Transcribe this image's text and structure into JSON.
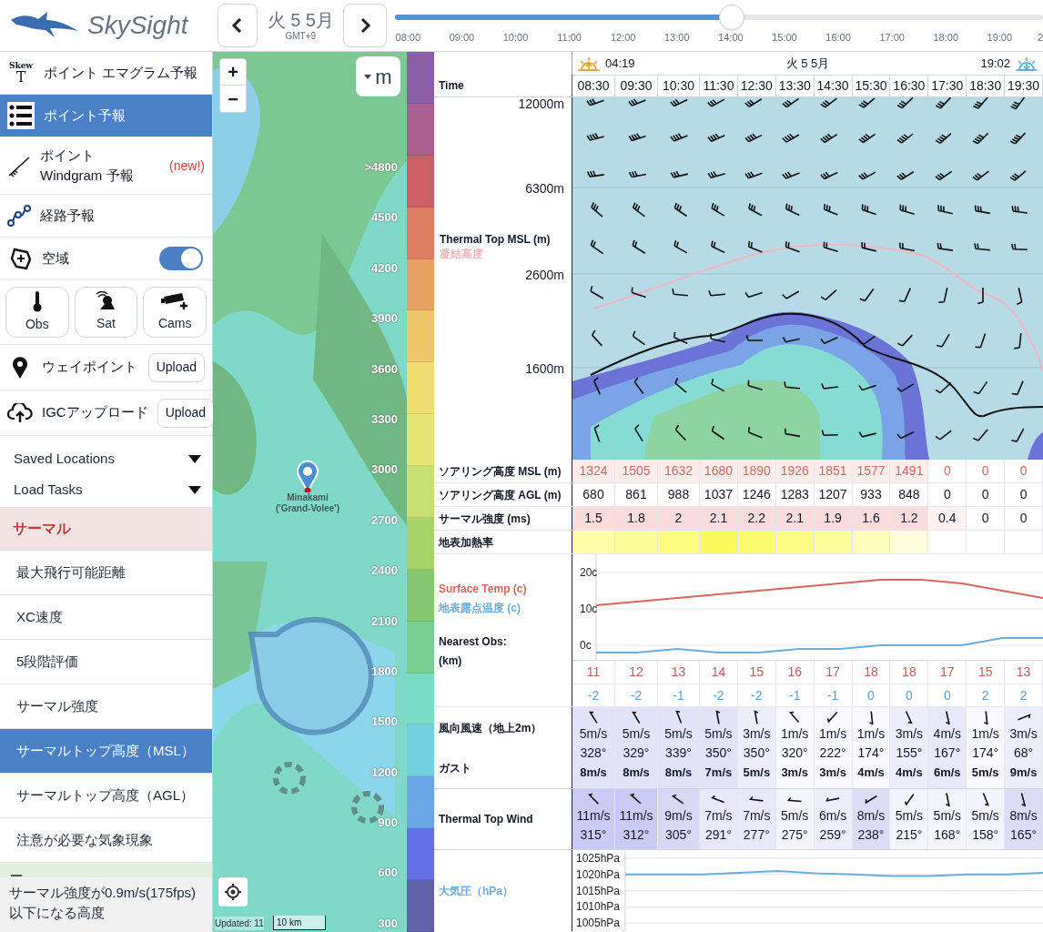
{
  "app": {
    "logo_text": "SkySight"
  },
  "date_nav": {
    "date": "火 5 5月",
    "timezone": "GMT+9"
  },
  "time_slider": {
    "level": 0.52,
    "ticks": [
      "08:00",
      "09:00",
      "10:00",
      "11:00",
      "12:00",
      "13:00",
      "14:00",
      "15:00",
      "16:00",
      "17:00",
      "18:00",
      "19:00",
      "2"
    ]
  },
  "sidebar": {
    "menu": [
      {
        "kind": "link",
        "icon_text": [
          "Skew",
          "T"
        ],
        "label": "ポイント エマグラム予報",
        "selected": false
      },
      {
        "kind": "link",
        "label": "ポイント予報",
        "selected": true
      },
      {
        "kind": "link",
        "label": "ポイント Windgram 予報",
        "badge": "(new!)",
        "selected": false
      },
      {
        "kind": "link",
        "label": "経路予報",
        "selected": false
      },
      {
        "kind": "toggle",
        "label": "空域",
        "on": true
      }
    ],
    "layer_buttons": [
      "Obs",
      "Sat",
      "Cams"
    ],
    "uploads": [
      {
        "label": "ウェイポイント",
        "button": "Upload"
      },
      {
        "label": "IGCアップロード",
        "button": "Upload"
      }
    ],
    "dropdowns": [
      "Saved Locations",
      "Load Tasks"
    ],
    "section": {
      "title": "サーマル",
      "items": [
        {
          "label": "最大飛行可能距離",
          "selected": false
        },
        {
          "label": "XC速度",
          "selected": false
        },
        {
          "label": "5段階評価",
          "selected": false
        },
        {
          "label": "サーマル強度",
          "selected": false
        },
        {
          "label": "サーマルトップ高度（MSL）",
          "selected": true
        },
        {
          "label": "サーマルトップ高度（AGL）",
          "selected": false
        },
        {
          "label": "注意が必要な気象現象",
          "selected": false
        }
      ]
    },
    "description": "サーマル強度が0.9m/s(175fps)以下になる高度"
  },
  "map": {
    "zoom_in": "+",
    "zoom_out": "−",
    "unit": "m",
    "pin_label": [
      "Minakami",
      "('Grand-Volee')"
    ],
    "updated": "Updated: 11",
    "scale": "10 km"
  },
  "legend": {
    "bands": [
      {
        "color": "#8c5ea6"
      },
      {
        "color": "#aa6090"
      },
      {
        "color": "#cd6067"
      },
      {
        "color": "#de7e62"
      },
      {
        "color": "#e9a163"
      },
      {
        "color": "#eec76a"
      },
      {
        "color": "#f0dd70"
      },
      {
        "color": "#e6e674"
      },
      {
        "color": "#c8e072"
      },
      {
        "color": "#a6d46a"
      },
      {
        "color": "#86c872"
      },
      {
        "color": "#7ad092"
      },
      {
        "color": "#78dcc6"
      },
      {
        "color": "#72d0e2"
      },
      {
        "color": "#6aa6e8"
      },
      {
        "color": "#6470e6"
      },
      {
        "color": "#6262aa"
      }
    ],
    "labels": [
      ">4800",
      "4500",
      "4200",
      "3900",
      "3600",
      "3300",
      "3000",
      "2700",
      "2400",
      "2100",
      "1800",
      "1500",
      "1200",
      "900",
      "600",
      "300"
    ]
  },
  "forecast": {
    "sunrise": "04:19",
    "date": "火 5 5月",
    "sunset": "19:02",
    "time_label": "Time",
    "times": [
      "08:30",
      "09:30",
      "10:30",
      "11:30",
      "12:30",
      "13:30",
      "14:30",
      "15:30",
      "16:30",
      "17:30",
      "18:30",
      "19:30"
    ],
    "cross_section": {
      "labels": [
        "Thermal Top MSL (m)",
        "凝結高度"
      ],
      "axis_ticks": [
        "12000m",
        "6300m",
        "2600m",
        "1600m"
      ]
    },
    "rows": [
      {
        "kind": "msl",
        "label": "ソアリング高度 MSL (m)",
        "cells": [
          {
            "text": "1324",
            "color": "#fcecec"
          },
          {
            "text": "1505",
            "color": "#fcecec"
          },
          {
            "text": "1632",
            "color": "#fcecec"
          },
          {
            "text": "1680",
            "color": "#fcecec"
          },
          {
            "text": "1890",
            "color": "#fcecec"
          },
          {
            "text": "1926",
            "color": "#fcecec"
          },
          {
            "text": "1851",
            "color": "#fcecec"
          },
          {
            "text": "1577",
            "color": "#fcecec"
          },
          {
            "text": "1491",
            "color": "#fcecec"
          },
          {
            "text": "0",
            "color": "#ffffff"
          },
          {
            "text": "0",
            "color": "#ffffff"
          },
          {
            "text": "0",
            "color": "#ffffff"
          }
        ]
      },
      {
        "kind": "agl",
        "label": "ソアリング高度 AGL (m)",
        "cells": [
          {
            "text": "680"
          },
          {
            "text": "861"
          },
          {
            "text": "988"
          },
          {
            "text": "1037"
          },
          {
            "text": "1246"
          },
          {
            "text": "1283"
          },
          {
            "text": "1207"
          },
          {
            "text": "933"
          },
          {
            "text": "848"
          },
          {
            "text": "0"
          },
          {
            "text": "0"
          },
          {
            "text": "0"
          }
        ]
      },
      {
        "kind": "strength",
        "label": "サーマル強度 (ms)",
        "cells": [
          {
            "text": "1.5",
            "color": "#fadcdc"
          },
          {
            "text": "1.8",
            "color": "#fadcdc"
          },
          {
            "text": "2",
            "color": "#fadcdc"
          },
          {
            "text": "2.1",
            "color": "#fadcdc"
          },
          {
            "text": "2.2",
            "color": "#fadcdc"
          },
          {
            "text": "2.1",
            "color": "#fadcdc"
          },
          {
            "text": "1.9",
            "color": "#fadcdc"
          },
          {
            "text": "1.6",
            "color": "#fadcdc"
          },
          {
            "text": "1.2",
            "color": "#fadcdc"
          },
          {
            "text": "0.4",
            "color": "#fdf1f1"
          },
          {
            "text": "0",
            "color": "#ffffff"
          },
          {
            "text": "0",
            "color": "#ffffff"
          }
        ]
      },
      {
        "kind": "heat",
        "label": "地表加熱率",
        "cells": [
          {
            "color": "#fefea8"
          },
          {
            "color": "#fcfc98"
          },
          {
            "color": "#fcfc80"
          },
          {
            "color": "#fafa5c"
          },
          {
            "color": "#fbfb70"
          },
          {
            "color": "#fcfc84"
          },
          {
            "color": "#fdfd9c"
          },
          {
            "color": "#fefebc"
          },
          {
            "color": "#fefedc"
          },
          {
            "color": "#ffffff"
          },
          {
            "color": "#ffffff"
          },
          {
            "color": "#ffffff"
          }
        ]
      }
    ],
    "temperature": {
      "chart_data": {
        "type": "line",
        "ylim": [
          -4,
          25
        ],
        "grid": true,
        "yticks": [
          {
            "value": 20,
            "label": "20c"
          },
          {
            "value": 10,
            "label": "10c"
          },
          {
            "value": 0,
            "label": "0c"
          }
        ],
        "series": [
          {
            "name": "Surface Temp (c)",
            "color": "#d9675f",
            "values": [
              11,
              12,
              13,
              14,
              15,
              16,
              17,
              18,
              18,
              17,
              15,
              13
            ]
          },
          {
            "name": "地表露点温度 (c)",
            "color": "#6aaee0",
            "values": [
              -2,
              -2,
              -1,
              -2,
              -2,
              -1,
              -1,
              0,
              0,
              0,
              2,
              2
            ]
          }
        ]
      }
    },
    "obs_label": [
      "Nearest Obs:",
      "(km)"
    ],
    "obs_rows": [
      {
        "kind": "temp",
        "cells": [
          "11",
          "12",
          "13",
          "14",
          "15",
          "16",
          "17",
          "18",
          "18",
          "17",
          "15",
          "13"
        ]
      },
      {
        "kind": "dew",
        "cells": [
          "-2",
          "-2",
          "-1",
          "-2",
          "-2",
          "-1",
          "-1",
          "0",
          "0",
          "0",
          "2",
          "2"
        ]
      }
    ],
    "wind_2m": {
      "labels": [
        "風向風速（地上2m）",
        "ガスト"
      ],
      "cells": [
        {
          "speed": "5m/s",
          "direction": "328°",
          "gust": "8m/s",
          "color": "#e2e2f8"
        },
        {
          "speed": "5m/s",
          "direction": "329°",
          "gust": "8m/s",
          "color": "#e2e2f8"
        },
        {
          "speed": "5m/s",
          "direction": "339°",
          "gust": "8m/s",
          "color": "#e2e2f8"
        },
        {
          "speed": "5m/s",
          "direction": "350°",
          "gust": "7m/s",
          "color": "#e2e2f8"
        },
        {
          "speed": "3m/s",
          "direction": "350°",
          "gust": "5m/s",
          "color": "#eeeefb"
        },
        {
          "speed": "1m/s",
          "direction": "320°",
          "gust": "3m/s",
          "color": "#f8f8fe"
        },
        {
          "speed": "1m/s",
          "direction": "222°",
          "gust": "3m/s",
          "color": "#f8f8fe"
        },
        {
          "speed": "1m/s",
          "direction": "174°",
          "gust": "4m/s",
          "color": "#f8f8fe"
        },
        {
          "speed": "3m/s",
          "direction": "155°",
          "gust": "4m/s",
          "color": "#eeeefb"
        },
        {
          "speed": "4m/s",
          "direction": "167°",
          "gust": "6m/s",
          "color": "#e8e8fa"
        },
        {
          "speed": "1m/s",
          "direction": "174°",
          "gust": "5m/s",
          "color": "#f8f8fe"
        },
        {
          "speed": "3m/s",
          "direction": "68°",
          "gust": "9m/s",
          "color": "#eeeefb"
        }
      ]
    },
    "thermal_wind": {
      "label": "Thermal Top Wind",
      "cells": [
        {
          "speed": "11m/s",
          "direction": "315°",
          "color": "#cacaf4"
        },
        {
          "speed": "11m/s",
          "direction": "312°",
          "color": "#cacaf4"
        },
        {
          "speed": "9m/s",
          "direction": "305°",
          "color": "#d8d8f6"
        },
        {
          "speed": "7m/s",
          "direction": "291°",
          "color": "#e8e8fa"
        },
        {
          "speed": "7m/s",
          "direction": "277°",
          "color": "#e8e8fa"
        },
        {
          "speed": "5m/s",
          "direction": "275°",
          "color": "#f4f4fc"
        },
        {
          "speed": "6m/s",
          "direction": "259°",
          "color": "#eeeefb"
        },
        {
          "speed": "8m/s",
          "direction": "238°",
          "color": "#dcdcf7"
        },
        {
          "speed": "5m/s",
          "direction": "215°",
          "color": "#f4f4fc"
        },
        {
          "speed": "5m/s",
          "direction": "168°",
          "color": "#f4f4fc"
        },
        {
          "speed": "5m/s",
          "direction": "158°",
          "color": "#f4f4fc"
        },
        {
          "speed": "8m/s",
          "direction": "165°",
          "color": "#dcdcf7"
        }
      ]
    },
    "pressure": {
      "chart_data": {
        "type": "line",
        "ylim": [
          1002.5,
          1027.5
        ],
        "grid": true,
        "yticks": [
          {
            "value": 1025,
            "label": "1025hPa"
          },
          {
            "value": 1020,
            "label": "1020hPa"
          },
          {
            "value": 1015,
            "label": "1015hPa"
          },
          {
            "value": 1010,
            "label": "1010hPa"
          },
          {
            "value": 1005,
            "label": "1005hPa"
          }
        ],
        "series": [
          {
            "name": "大気圧（hPa）",
            "color": "#6aaee0",
            "values": [
              1020,
              1020,
              1020,
              1020.5,
              1021,
              1020.3,
              1020,
              1019.5,
              1019.5,
              1020,
              1020,
              1020.5
            ]
          }
        ]
      }
    }
  }
}
